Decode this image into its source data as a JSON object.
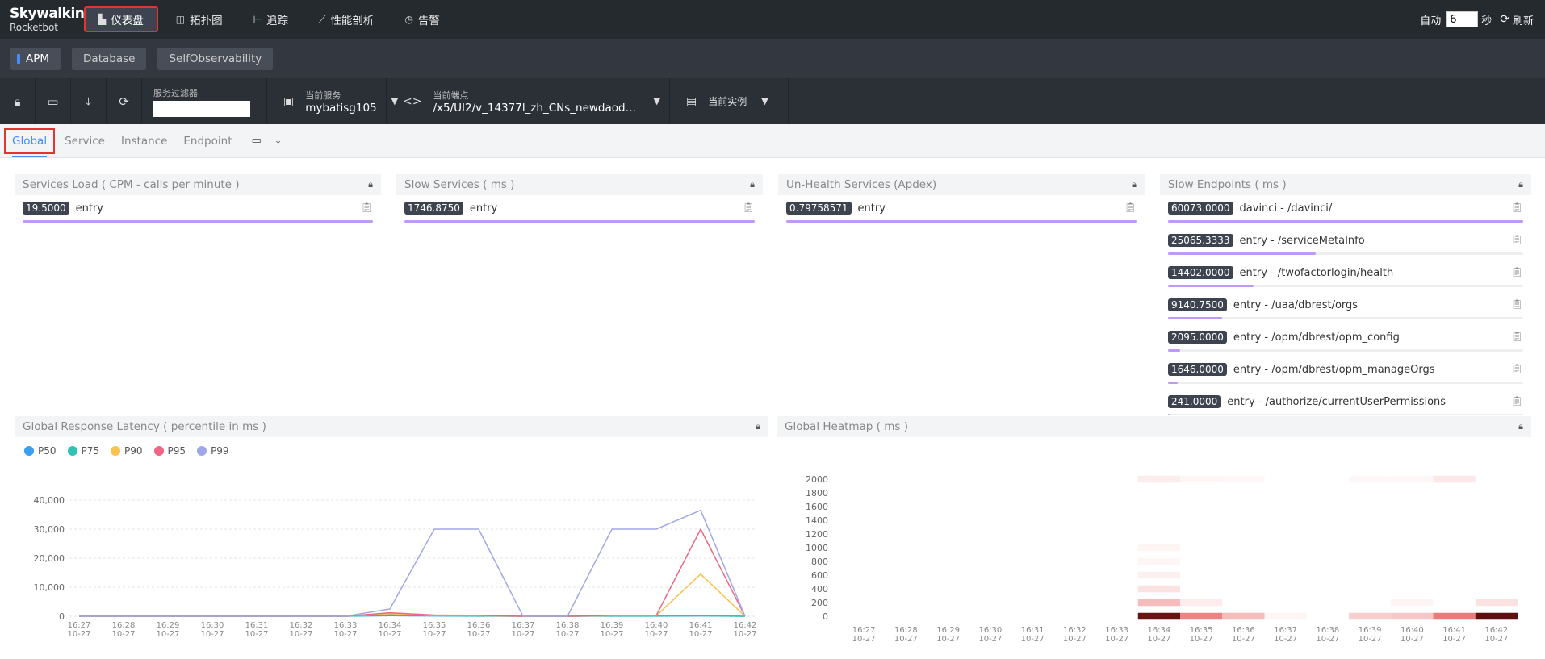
{
  "app": {
    "logo_top": "Skywalking",
    "logo_bottom": "Rocketbot"
  },
  "nav": [
    {
      "label": "仪表盘",
      "icon": "dashboard-icon",
      "glyph": "▙",
      "active": true
    },
    {
      "label": "拓扑图",
      "icon": "topology-icon",
      "glyph": "◫"
    },
    {
      "label": "追踪",
      "icon": "trace-icon",
      "glyph": "⊢"
    },
    {
      "label": "性能剖析",
      "icon": "profile-icon",
      "glyph": "⟋"
    },
    {
      "label": "告警",
      "icon": "alarm-icon",
      "glyph": "◷"
    }
  ],
  "topright": {
    "auto_label": "自动",
    "auto_value": "6",
    "unit": "秒",
    "refresh_label": "刷新"
  },
  "subtabs": [
    {
      "label": "APM",
      "active": true
    },
    {
      "label": "Database"
    },
    {
      "label": "SelfObservability"
    }
  ],
  "toolbar": {
    "filter_label": "服务过滤器",
    "filter_value": "",
    "service_label": "当前服务",
    "service_value": "mybatisg105",
    "endpoint_label": "当前端点",
    "endpoint_value": "/x5/UI2/v_14377l_zh_CNs_newdaod_p...",
    "instance_label": "当前实例"
  },
  "dashtabs": [
    {
      "label": "Global",
      "active": true
    },
    {
      "label": "Service"
    },
    {
      "label": "Instance"
    },
    {
      "label": "Endpoint"
    }
  ],
  "panels": {
    "services_load": {
      "title": "Services Load ( CPM - calls per minute )",
      "rows": [
        {
          "value": "19.5000",
          "name": "entry",
          "ratio": 1.0
        }
      ]
    },
    "slow_services": {
      "title": "Slow Services ( ms )",
      "rows": [
        {
          "value": "1746.8750",
          "name": "entry",
          "ratio": 1.0
        }
      ]
    },
    "unhealth_services": {
      "title": "Un-Health Services (Apdex)",
      "rows": [
        {
          "value": "0.79758571",
          "name": "entry",
          "ratio": 1.0
        }
      ]
    },
    "slow_endpoints": {
      "title": "Slow Endpoints ( ms )",
      "rows": [
        {
          "value": "60073.0000",
          "name": "davinci - /davinci/",
          "ratio": 1.0
        },
        {
          "value": "25065.3333",
          "name": "entry - /serviceMetaInfo",
          "ratio": 0.417
        },
        {
          "value": "14402.0000",
          "name": "entry - /twofactorlogin/health",
          "ratio": 0.24
        },
        {
          "value": "9140.7500",
          "name": "entry - /uaa/dbrest/orgs",
          "ratio": 0.152
        },
        {
          "value": "2095.0000",
          "name": "entry - /opm/dbrest/opm_config",
          "ratio": 0.035
        },
        {
          "value": "1646.0000",
          "name": "entry - /opm/dbrest/opm_manageOrgs",
          "ratio": 0.027
        },
        {
          "value": "241.0000",
          "name": "entry - /authorize/currentUserPermissions",
          "ratio": 0.004
        }
      ]
    },
    "latency": {
      "title": "Global Response Latency ( percentile in ms )"
    },
    "heatmap": {
      "title": "Global Heatmap ( ms )"
    }
  },
  "chart_data": [
    {
      "type": "line",
      "title": "Global Response Latency ( percentile in ms )",
      "x": [
        "16:27",
        "16:28",
        "16:29",
        "16:30",
        "16:31",
        "16:32",
        "16:33",
        "16:34",
        "16:35",
        "16:36",
        "16:37",
        "16:38",
        "16:39",
        "16:40",
        "16:41",
        "16:42"
      ],
      "x_sub": "10-27",
      "ylim": [
        0,
        40000
      ],
      "yticks": [
        "0",
        "10,000",
        "20,000",
        "30,000",
        "40,000"
      ],
      "legend_position": "top-left",
      "series": [
        {
          "name": "P50",
          "color": "#3a9ff0",
          "values": [
            0,
            0,
            0,
            0,
            0,
            0,
            0,
            200,
            100,
            50,
            0,
            0,
            50,
            50,
            100,
            0
          ]
        },
        {
          "name": "P75",
          "color": "#30c2b4",
          "values": [
            0,
            0,
            0,
            0,
            0,
            0,
            0,
            500,
            200,
            100,
            0,
            0,
            100,
            100,
            200,
            0
          ]
        },
        {
          "name": "P90",
          "color": "#fac24f",
          "values": [
            0,
            0,
            0,
            0,
            0,
            0,
            0,
            900,
            300,
            200,
            0,
            0,
            200,
            200,
            14500,
            0
          ]
        },
        {
          "name": "P95",
          "color": "#f06683",
          "values": [
            0,
            0,
            0,
            0,
            0,
            0,
            0,
            1200,
            400,
            300,
            0,
            0,
            300,
            300,
            30000,
            0
          ]
        },
        {
          "name": "P99",
          "color": "#a0a7e6",
          "values": [
            0,
            0,
            0,
            0,
            0,
            0,
            0,
            2500,
            30000,
            30000,
            0,
            0,
            30000,
            30000,
            36500,
            0
          ]
        }
      ]
    },
    {
      "type": "heatmap",
      "title": "Global Heatmap ( ms )",
      "x": [
        "16:27",
        "16:28",
        "16:29",
        "16:30",
        "16:31",
        "16:32",
        "16:33",
        "16:34",
        "16:35",
        "16:36",
        "16:37",
        "16:38",
        "16:39",
        "16:40",
        "16:41",
        "16:42"
      ],
      "x_sub": "10-27",
      "y": [
        0,
        200,
        400,
        600,
        800,
        1000,
        1200,
        1400,
        1600,
        1800,
        2000
      ],
      "cells": [
        {
          "x": 7,
          "y": 0,
          "v": 1.0
        },
        {
          "x": 7,
          "y": 1,
          "v": 0.35
        },
        {
          "x": 7,
          "y": 2,
          "v": 0.15
        },
        {
          "x": 7,
          "y": 3,
          "v": 0.08
        },
        {
          "x": 7,
          "y": 4,
          "v": 0.05
        },
        {
          "x": 7,
          "y": 10,
          "v": 0.1
        },
        {
          "x": 7,
          "y": 5,
          "v": 0.06
        },
        {
          "x": 8,
          "y": 0,
          "v": 0.65
        },
        {
          "x": 8,
          "y": 1,
          "v": 0.1
        },
        {
          "x": 8,
          "y": 10,
          "v": 0.05
        },
        {
          "x": 9,
          "y": 0,
          "v": 0.35
        },
        {
          "x": 9,
          "y": 10,
          "v": 0.04
        },
        {
          "x": 10,
          "y": 0,
          "v": 0.05
        },
        {
          "x": 12,
          "y": 0,
          "v": 0.25
        },
        {
          "x": 12,
          "y": 10,
          "v": 0.04
        },
        {
          "x": 13,
          "y": 0,
          "v": 0.3
        },
        {
          "x": 13,
          "y": 1,
          "v": 0.06
        },
        {
          "x": 13,
          "y": 10,
          "v": 0.04
        },
        {
          "x": 14,
          "y": 0,
          "v": 0.7
        },
        {
          "x": 14,
          "y": 10,
          "v": 0.12
        },
        {
          "x": 15,
          "y": 0,
          "v": 1.2
        },
        {
          "x": 15,
          "y": 1,
          "v": 0.15
        }
      ]
    }
  ]
}
